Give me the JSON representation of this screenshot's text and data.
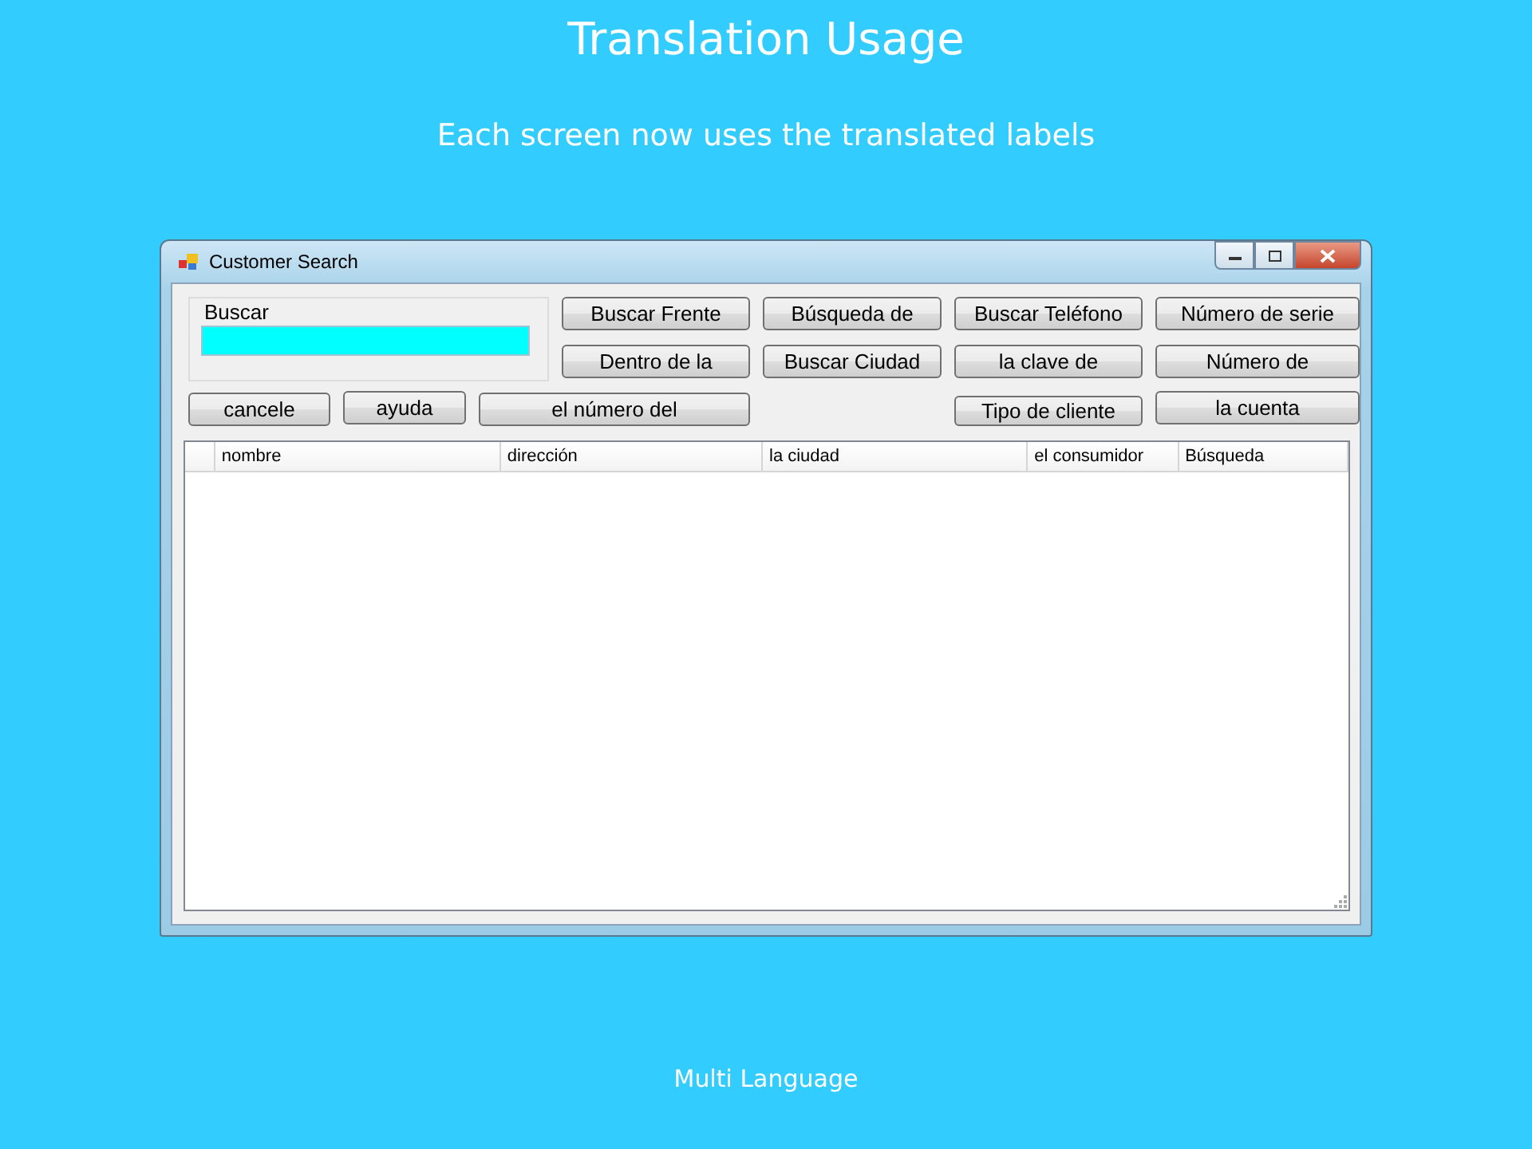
{
  "slide": {
    "title": "Translation Usage",
    "subtitle": "Each screen now uses the translated labels",
    "footer": "Multi Language"
  },
  "window": {
    "title": "Customer Search",
    "search_group": {
      "label": "Buscar"
    },
    "buttons": [
      "Buscar Frente",
      "Búsqueda de",
      "Buscar Teléfono",
      "Número de serie",
      "Dentro de la",
      "Buscar Ciudad",
      "la clave de",
      "Número de",
      "cancele",
      "ayuda",
      "el número del",
      "Tipo de cliente",
      "la cuenta"
    ],
    "table": {
      "columns": [
        "nombre",
        "dirección",
        "la ciudad",
        "el consumidor",
        "Búsqueda"
      ]
    }
  }
}
